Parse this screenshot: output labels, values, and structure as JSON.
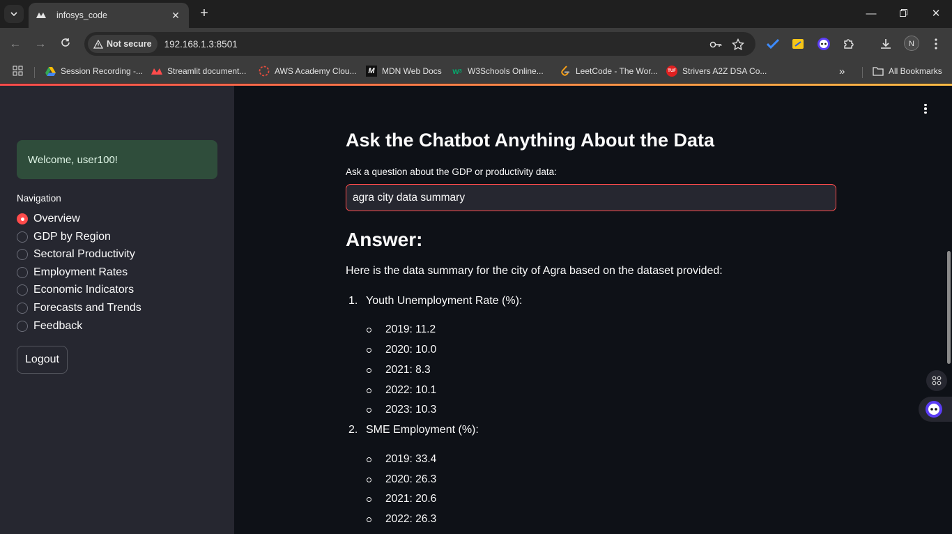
{
  "browser": {
    "tab_title": "infosys_code",
    "security_label": "Not secure",
    "url": "192.168.1.3:8501",
    "profile_initial": "N",
    "bookmarks": [
      {
        "label": "Session Recording -...",
        "icon": "google-drive-icon"
      },
      {
        "label": "Streamlit document...",
        "icon": "streamlit-icon"
      },
      {
        "label": "AWS Academy Clou...",
        "icon": "aws-academy-icon"
      },
      {
        "label": "MDN Web Docs",
        "icon": "mdn-icon"
      },
      {
        "label": "W3Schools Online...",
        "icon": "w3schools-icon"
      },
      {
        "label": "LeetCode - The Wor...",
        "icon": "leetcode-icon"
      },
      {
        "label": "Strivers A2Z DSA Co...",
        "icon": "tuf-icon"
      }
    ],
    "all_bookmarks_label": "All Bookmarks"
  },
  "sidebar": {
    "welcome": "Welcome, user100!",
    "nav_label": "Navigation",
    "nav_options": [
      "Overview",
      "GDP by Region",
      "Sectoral Productivity",
      "Employment Rates",
      "Economic Indicators",
      "Forecasts and Trends",
      "Feedback"
    ],
    "selected_index": 0,
    "logout_label": "Logout"
  },
  "main": {
    "heading": "Ask the Chatbot Anything About the Data",
    "input_label": "Ask a question about the GDP or productivity data:",
    "input_value": "agra city data summary",
    "answer_heading": "Answer:",
    "intro": "Here is the data summary for the city of Agra based on the dataset provided:",
    "sections": [
      {
        "num": "1.",
        "title": "Youth Unemployment Rate (%):",
        "items": [
          "2019: 11.2",
          "2020: 10.0",
          "2021: 8.3",
          "2022: 10.1",
          "2023: 10.3"
        ]
      },
      {
        "num": "2.",
        "title": "SME Employment (%):",
        "items": [
          "2019: 33.4",
          "2020: 26.3",
          "2021: 20.6",
          "2022: 26.3"
        ]
      }
    ]
  },
  "colors": {
    "accent": "#ff4b4b",
    "sidebar_bg": "#262730",
    "main_bg": "#0e1117",
    "success_bg": "#2f4d3b"
  }
}
